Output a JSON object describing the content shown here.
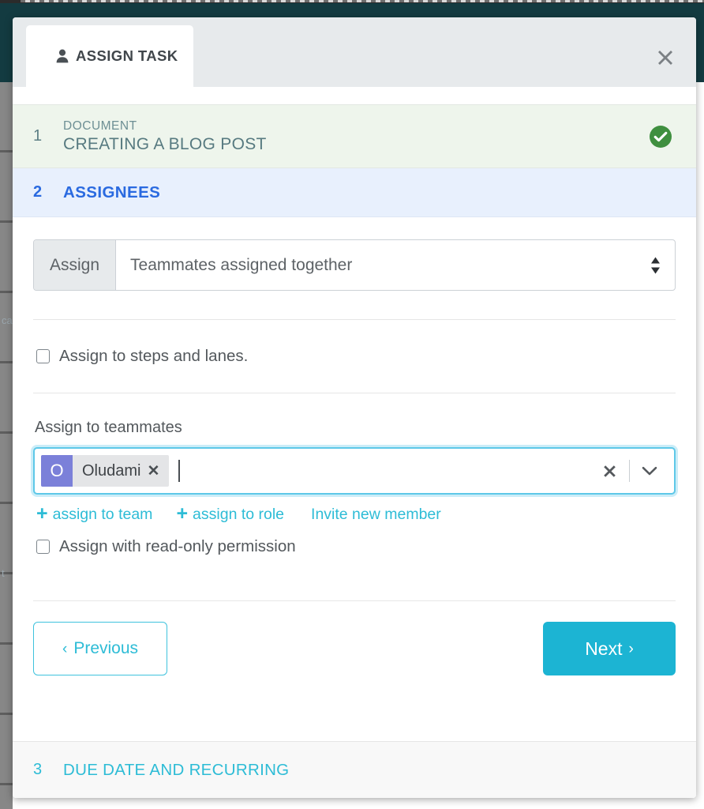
{
  "window": {
    "close_icon": "close-x-icon"
  },
  "tab": {
    "icon": "person-icon",
    "label": "ASSIGN TASK"
  },
  "steps": [
    {
      "number": "1",
      "kicker": "DOCUMENT",
      "title": "CREATING A BLOG POST",
      "status_icon": "check-circle-icon",
      "state": "completed"
    },
    {
      "number": "2",
      "title": "ASSIGNEES",
      "state": "active"
    },
    {
      "number": "3",
      "title": "DUE DATE AND RECURRING",
      "state": "upcoming"
    }
  ],
  "form": {
    "assign_addon_label": "Assign",
    "assign_select_value": "Teammates assigned together",
    "assign_select_icon": "updown-arrows-icon",
    "steps_lanes_checkbox": {
      "label": "Assign to steps and lanes.",
      "checked": false
    },
    "teammates_label": "Assign to teammates",
    "token": {
      "avatar_initial": "O",
      "name": "Oludami",
      "remove_icon": "token-remove-x-icon"
    },
    "token_input_clear_icon": "clear-all-x-icon",
    "token_input_chevron_icon": "chevron-down-icon",
    "links": [
      {
        "plus": "+",
        "label": "assign to team",
        "has_plus": true
      },
      {
        "plus": "+",
        "label": "assign to role",
        "has_plus": true
      },
      {
        "plus": "",
        "label": "Invite new member",
        "has_plus": false
      }
    ],
    "readonly_checkbox": {
      "label": "Assign with read-only permission",
      "checked": false
    }
  },
  "footer": {
    "previous_label": "Previous",
    "previous_chevron": "‹",
    "next_label": "Next",
    "next_chevron": "›"
  },
  "colors": {
    "accent_cyan": "#2dbcd6",
    "active_blue": "#2a6ae0",
    "completed_green": "#3f8f3f",
    "avatar_purple": "#7b80d9",
    "backdrop_teal": "#133b41"
  }
}
